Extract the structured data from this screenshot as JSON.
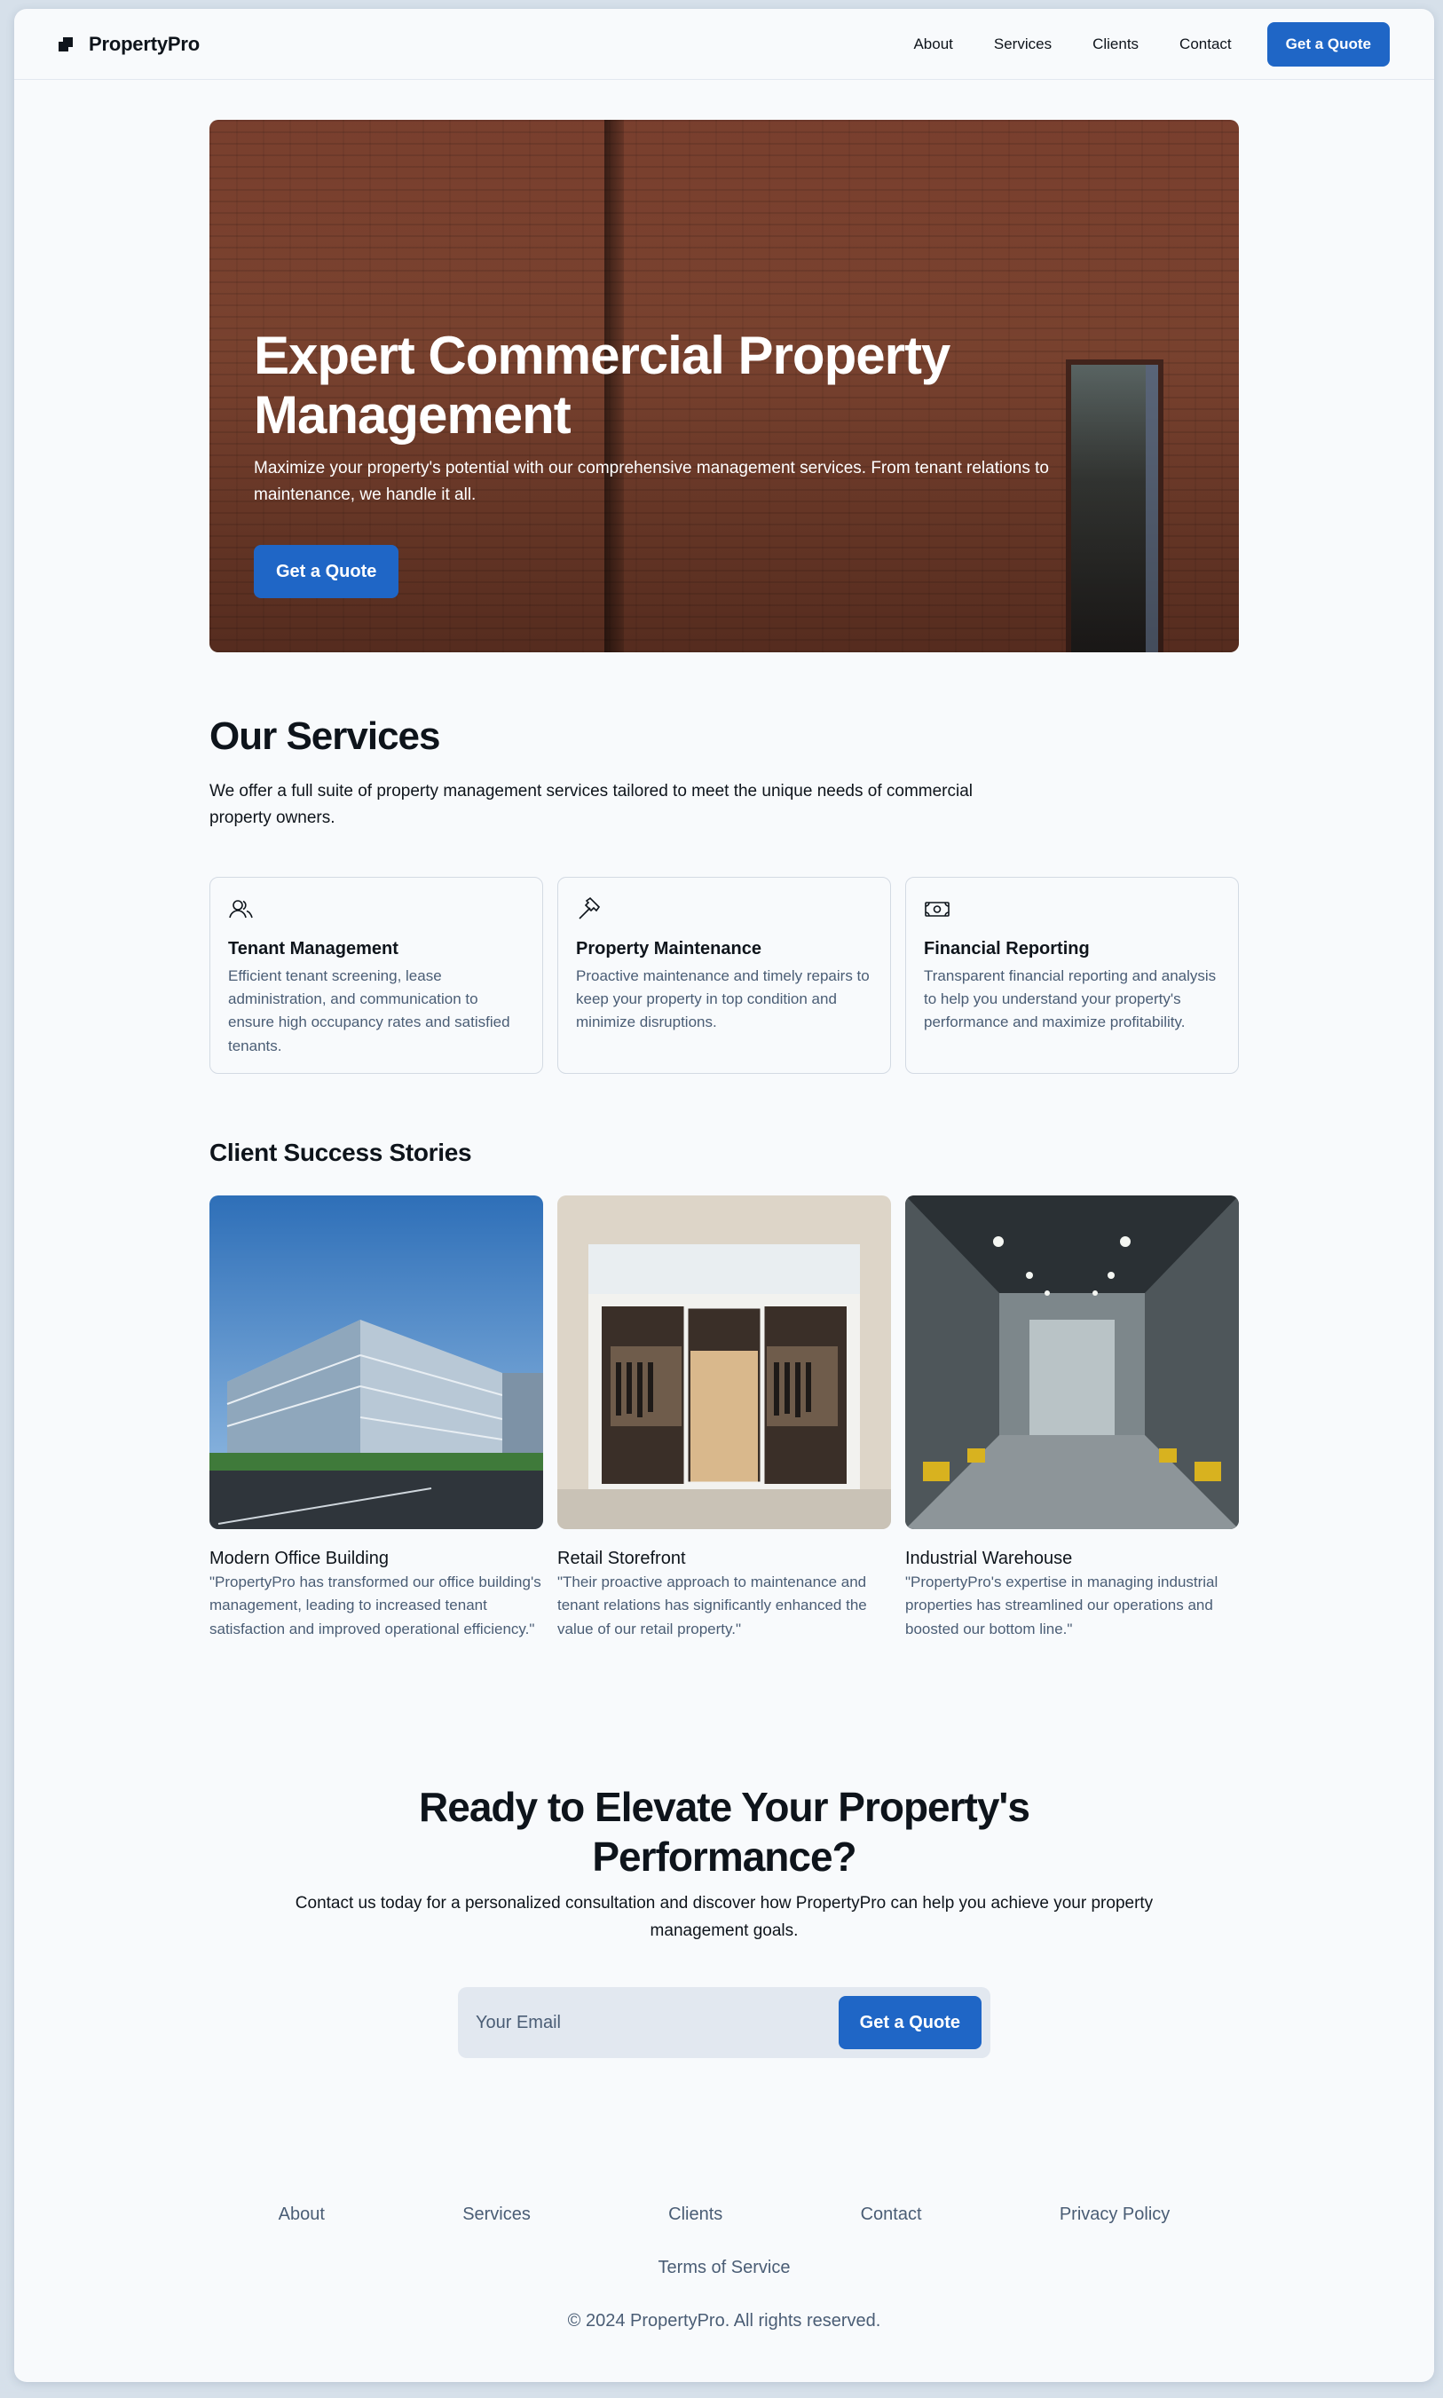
{
  "header": {
    "brand": "PropertyPro",
    "nav": [
      "About",
      "Services",
      "Clients",
      "Contact"
    ],
    "cta": "Get a Quote"
  },
  "hero": {
    "title": "Expert Commercial Property Management",
    "subtitle": "Maximize your property's potential with our comprehensive management services. From tenant relations to maintenance, we handle it all.",
    "cta": "Get a Quote"
  },
  "services": {
    "title": "Our Services",
    "description": "We offer a full suite of property management services tailored to meet the unique needs of commercial property owners.",
    "cards": [
      {
        "icon": "users-icon",
        "title": "Tenant Management",
        "text": "Efficient tenant screening, lease administration, and communication to ensure high occupancy rates and satisfied tenants."
      },
      {
        "icon": "hammer-icon",
        "title": "Property Maintenance",
        "text": "Proactive maintenance and timely repairs to keep your property in top condition and minimize disruptions."
      },
      {
        "icon": "money-icon",
        "title": "Financial Reporting",
        "text": "Transparent financial reporting and analysis to help you understand your property's performance and maximize profitability."
      }
    ]
  },
  "clients": {
    "title": "Client Success Stories",
    "items": [
      {
        "name": "Modern Office Building",
        "quote": "\"PropertyPro has transformed our office building's management, leading to increased tenant satisfaction and improved operational efficiency.\""
      },
      {
        "name": "Retail Storefront",
        "quote": "\"Their proactive approach to maintenance and tenant relations has significantly enhanced the value of our retail property.\""
      },
      {
        "name": "Industrial Warehouse",
        "quote": "\"PropertyPro's expertise in managing industrial properties has streamlined our operations and boosted our bottom line.\""
      }
    ]
  },
  "cta": {
    "title": "Ready to Elevate Your Property's Performance?",
    "subtitle": "Contact us today for a personalized consultation and discover how PropertyPro can help you achieve your property management goals.",
    "email_placeholder": "Your Email",
    "button": "Get a Quote"
  },
  "footer": {
    "links": [
      "About",
      "Services",
      "Clients",
      "Contact",
      "Privacy Policy"
    ],
    "terms": "Terms of Service",
    "copyright": "© 2024 PropertyPro. All rights reserved."
  },
  "colors": {
    "accent": "#1f66c6",
    "muted_text": "#4a5d75",
    "page_bg": "#f8fafc"
  }
}
